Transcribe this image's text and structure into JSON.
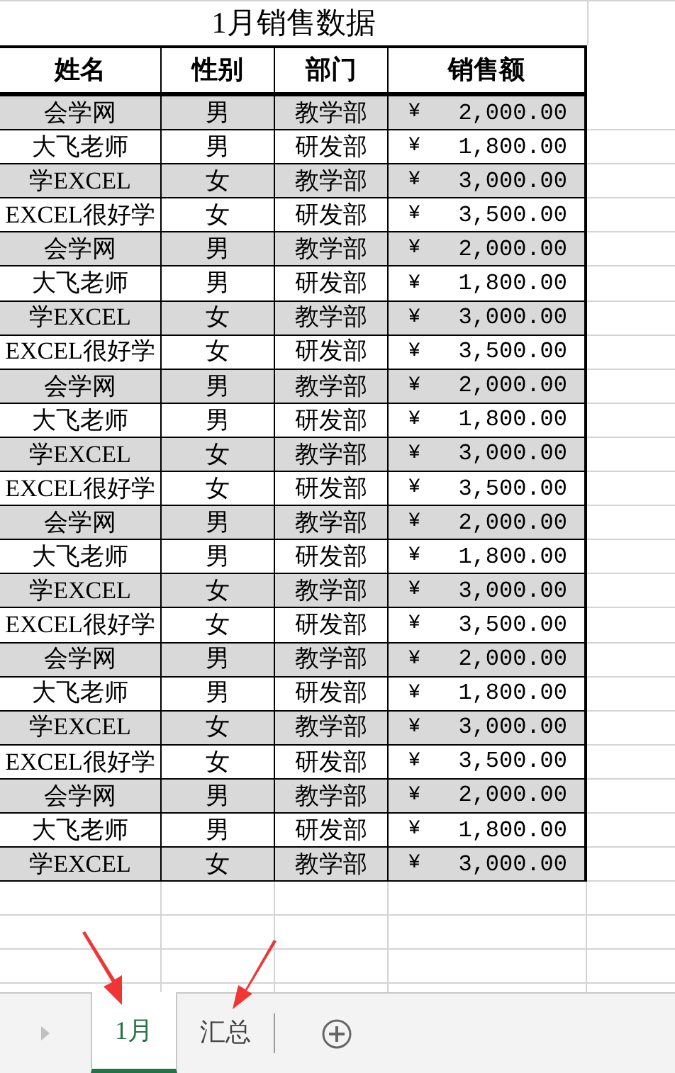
{
  "title": "1月销售数据",
  "table": {
    "columns": [
      "姓名",
      "性别",
      "部门",
      "销售额"
    ],
    "rows": [
      {
        "name": "会学网",
        "gender": "男",
        "department": "教学部",
        "currency": "¥",
        "amount": "2,000.00",
        "shaded": true
      },
      {
        "name": "大飞老师",
        "gender": "男",
        "department": "研发部",
        "currency": "¥",
        "amount": "1,800.00",
        "shaded": false
      },
      {
        "name": "学EXCEL",
        "gender": "女",
        "department": "教学部",
        "currency": "¥",
        "amount": "3,000.00",
        "shaded": true
      },
      {
        "name": "EXCEL很好学",
        "gender": "女",
        "department": "研发部",
        "currency": "¥",
        "amount": "3,500.00",
        "shaded": false
      },
      {
        "name": "会学网",
        "gender": "男",
        "department": "教学部",
        "currency": "¥",
        "amount": "2,000.00",
        "shaded": true
      },
      {
        "name": "大飞老师",
        "gender": "男",
        "department": "研发部",
        "currency": "¥",
        "amount": "1,800.00",
        "shaded": false
      },
      {
        "name": "学EXCEL",
        "gender": "女",
        "department": "教学部",
        "currency": "¥",
        "amount": "3,000.00",
        "shaded": true
      },
      {
        "name": "EXCEL很好学",
        "gender": "女",
        "department": "研发部",
        "currency": "¥",
        "amount": "3,500.00",
        "shaded": false
      },
      {
        "name": "会学网",
        "gender": "男",
        "department": "教学部",
        "currency": "¥",
        "amount": "2,000.00",
        "shaded": true
      },
      {
        "name": "大飞老师",
        "gender": "男",
        "department": "研发部",
        "currency": "¥",
        "amount": "1,800.00",
        "shaded": false
      },
      {
        "name": "学EXCEL",
        "gender": "女",
        "department": "教学部",
        "currency": "¥",
        "amount": "3,000.00",
        "shaded": true
      },
      {
        "name": "EXCEL很好学",
        "gender": "女",
        "department": "研发部",
        "currency": "¥",
        "amount": "3,500.00",
        "shaded": false
      },
      {
        "name": "会学网",
        "gender": "男",
        "department": "教学部",
        "currency": "¥",
        "amount": "2,000.00",
        "shaded": true
      },
      {
        "name": "大飞老师",
        "gender": "男",
        "department": "研发部",
        "currency": "¥",
        "amount": "1,800.00",
        "shaded": false
      },
      {
        "name": "学EXCEL",
        "gender": "女",
        "department": "教学部",
        "currency": "¥",
        "amount": "3,000.00",
        "shaded": true
      },
      {
        "name": "EXCEL很好学",
        "gender": "女",
        "department": "研发部",
        "currency": "¥",
        "amount": "3,500.00",
        "shaded": false
      },
      {
        "name": "会学网",
        "gender": "男",
        "department": "教学部",
        "currency": "¥",
        "amount": "2,000.00",
        "shaded": true
      },
      {
        "name": "大飞老师",
        "gender": "男",
        "department": "研发部",
        "currency": "¥",
        "amount": "1,800.00",
        "shaded": false
      },
      {
        "name": "学EXCEL",
        "gender": "女",
        "department": "教学部",
        "currency": "¥",
        "amount": "3,000.00",
        "shaded": true
      },
      {
        "name": "EXCEL很好学",
        "gender": "女",
        "department": "研发部",
        "currency": "¥",
        "amount": "3,500.00",
        "shaded": false
      },
      {
        "name": "会学网",
        "gender": "男",
        "department": "教学部",
        "currency": "¥",
        "amount": "2,000.00",
        "shaded": true
      },
      {
        "name": "大飞老师",
        "gender": "男",
        "department": "研发部",
        "currency": "¥",
        "amount": "1,800.00",
        "shaded": false
      },
      {
        "name": "学EXCEL",
        "gender": "女",
        "department": "教学部",
        "currency": "¥",
        "amount": "3,000.00",
        "shaded": true
      }
    ]
  },
  "sheet_tabs": [
    {
      "label": "1月",
      "selected": true
    },
    {
      "label": "汇总",
      "selected": false
    }
  ]
}
